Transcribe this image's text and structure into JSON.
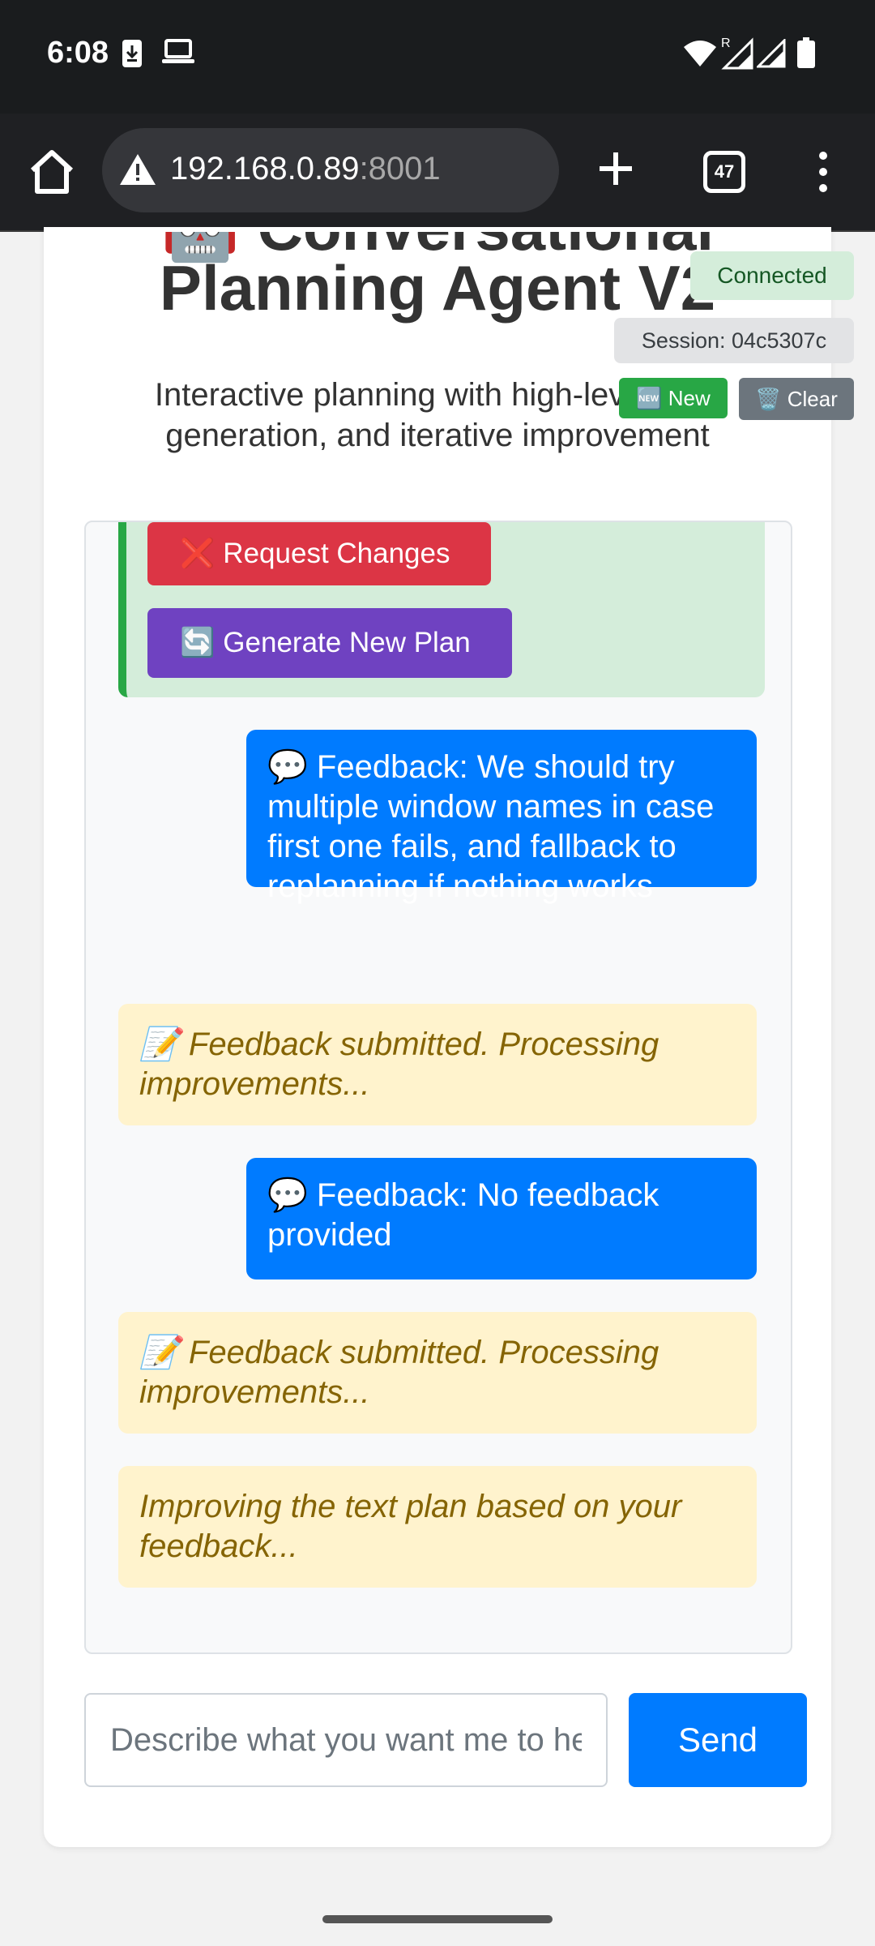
{
  "status_bar": {
    "time": "6:08",
    "icons": [
      "download-icon",
      "laptop-icon",
      "wifi-icon",
      "signal-roaming-icon",
      "signal-icon",
      "battery-icon"
    ]
  },
  "browser": {
    "url_host": "192.168.0.89",
    "url_port": ":8001",
    "tab_count": "47",
    "icons": [
      "home-icon",
      "warning-icon",
      "plus-icon",
      "tabs-icon",
      "more-vert-icon"
    ]
  },
  "header": {
    "title_line1": "🤖 Conversational",
    "title_line2": "Planning Agent V2",
    "subtitle": "Interactive planning with high-level plan generation, and iterative improvement",
    "connection_status": "Connected",
    "session": "Session: 04c5307c",
    "new_label": "🆕 New",
    "clear_label": "🗑️ Clear"
  },
  "chat": {
    "request_changes_label": "❌ Request Changes",
    "generate_new_plan_label": "🔄 Generate New Plan",
    "messages": [
      {
        "type": "user",
        "text": "💬 Feedback: We should try multiple window names in case first one fails, and fallback to replanning if nothing works"
      },
      {
        "type": "system",
        "text": "📝 Feedback submitted. Processing improvements..."
      },
      {
        "type": "user",
        "text": "💬 Feedback: No feedback provided"
      },
      {
        "type": "system",
        "text": "📝 Feedback submitted. Processing improvements..."
      },
      {
        "type": "system",
        "text": "Improving the text plan based on your feedback..."
      }
    ]
  },
  "composer": {
    "placeholder": "Describe what you want me to help you plan...",
    "send_label": "Send"
  },
  "colors": {
    "primary": "#007bff",
    "success": "#28a745",
    "danger": "#dc3545",
    "purple": "#6f42c1",
    "warning_bg": "#fff3cd",
    "warning_text": "#856404"
  }
}
